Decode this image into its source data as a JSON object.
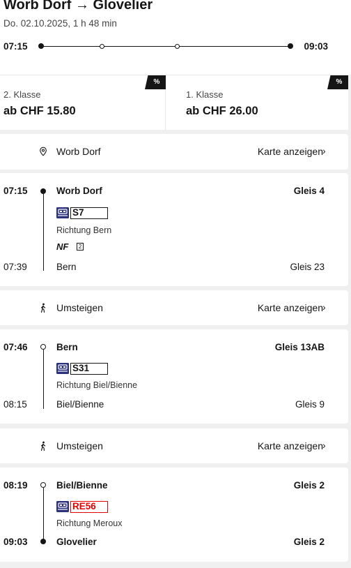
{
  "header": {
    "title": "Worb Dorf → Glovelier",
    "date_duration": "Do. 02.10.2025, 1 h 48 min",
    "departure": "07:15",
    "arrival": "09:03"
  },
  "prices": [
    {
      "class_label": "2. Klasse",
      "price": "ab CHF 15.80",
      "discount": "%"
    },
    {
      "class_label": "1. Klasse",
      "price": "ab CHF 26.00",
      "discount": "%"
    }
  ],
  "origin_row": {
    "label": "Worb Dorf",
    "map_link": "Karte anzeigen",
    "icon": "location-pin-icon"
  },
  "legs": [
    {
      "dep_time": "07:15",
      "dep_stop": "Worb Dorf",
      "dep_platform": "Gleis 4",
      "mode_icon": "train-icon",
      "line": "S7",
      "direction": "Richtung Bern",
      "attribute": "NF",
      "attribute_box": "2",
      "arr_time": "07:39",
      "arr_stop": "Bern",
      "arr_platform": "Gleis 23"
    },
    {
      "dep_time": "07:46",
      "dep_stop": "Bern",
      "dep_platform": "Gleis 13AB",
      "mode_icon": "train-icon",
      "line": "S31",
      "direction": "Richtung Biel/Bienne",
      "arr_time": "08:15",
      "arr_stop": "Biel/Bienne",
      "arr_platform": "Gleis 9"
    },
    {
      "dep_time": "08:19",
      "dep_stop": "Biel/Bienne",
      "dep_platform": "Gleis 2",
      "mode_icon": "train-icon",
      "line": "RE56",
      "line_color": "#eb0000",
      "direction": "Richtung Meroux",
      "arr_time": "09:03",
      "arr_stop": "Glovelier",
      "arr_platform": "Gleis 2"
    }
  ],
  "transfers": [
    {
      "label": "Umsteigen",
      "map_link": "Karte anzeigen",
      "icon": "walking-icon"
    },
    {
      "label": "Umsteigen",
      "map_link": "Karte anzeigen",
      "icon": "walking-icon"
    }
  ],
  "chevron": "›",
  "colors": {
    "accent": "#eb0000",
    "text": "#151515",
    "background": "#f0f0f0",
    "icon_blue": "#2d327d"
  }
}
